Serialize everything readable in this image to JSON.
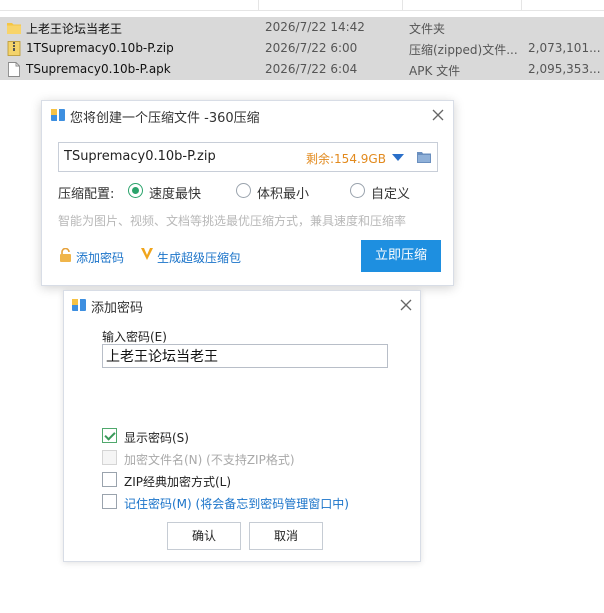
{
  "file_list": {
    "rows": [
      {
        "name": "上老王论坛当老王",
        "date": "2026/7/22 14:42",
        "type": "文件夹",
        "size": "",
        "icon": "folder-icon"
      },
      {
        "name": "1TSupremacy0.10b-P.zip",
        "date": "2026/7/22 6:00",
        "type": "压缩(zipped)文件...",
        "size": "2,073,101...",
        "icon": "zip-file-icon"
      },
      {
        "name": "TSupremacy0.10b-P.apk",
        "date": "2026/7/22 6:04",
        "type": "APK 文件",
        "size": "2,095,353...",
        "icon": "document-icon"
      }
    ]
  },
  "compress_dialog": {
    "title": "您将创建一个压缩文件 -360压缩",
    "filename": "TSupremacy0.10b-P.zip",
    "free_space": "剩余:154.9GB",
    "config_label": "压缩配置:",
    "options": [
      "速度最快",
      "体积最小",
      "自定义"
    ],
    "selected_option": "速度最快",
    "hint": "智能为图片、视频、文档等挑选最优压缩方式，兼具速度和压缩率",
    "add_password_link": "添加密码",
    "super_package_link": "生成超级压缩包",
    "compress_button": "立即压缩",
    "accent_color": "#1e8fe0"
  },
  "password_dialog": {
    "title": "添加密码",
    "input_label": "输入密码(E)",
    "password_value": "上老王论坛当老王",
    "checkboxes": [
      {
        "label": "显示密码(S)",
        "checked": true,
        "enabled": true
      },
      {
        "label": "加密文件名(N) (不支持ZIP格式)",
        "checked": false,
        "enabled": false
      },
      {
        "label": "ZIP经典加密方式(L)",
        "checked": false,
        "enabled": true
      },
      {
        "label": "记住密码(M) (将会备忘到密码管理窗口中)",
        "checked": false,
        "enabled": true
      }
    ],
    "confirm_button": "确认",
    "cancel_button": "取消"
  }
}
